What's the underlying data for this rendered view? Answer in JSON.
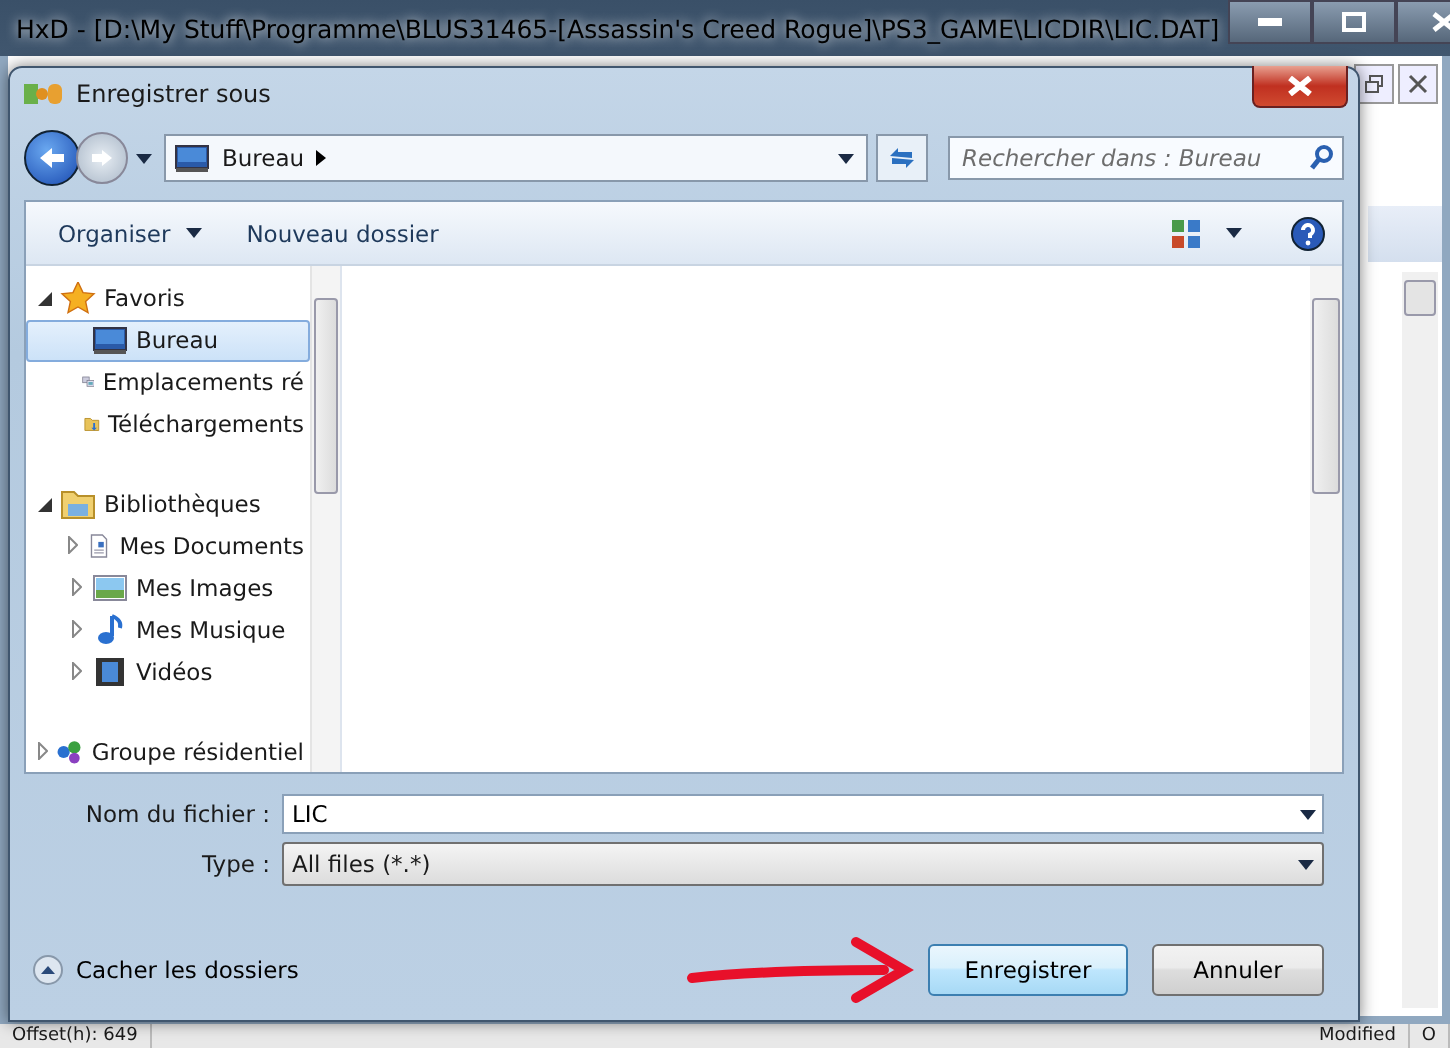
{
  "background_window": {
    "title": "HxD - [D:\\My Stuff\\Programme\\BLUS31465-[Assassin's Creed Rogue]\\PS3_GAME\\LICDIR\\LIC.DAT]",
    "status_bar": [
      "Offset(h): 649",
      "Modified",
      "O"
    ]
  },
  "dialog": {
    "title": "Enregistrer sous",
    "address": "Bureau",
    "search": {
      "placeholder": "Rechercher dans : Bureau"
    },
    "toolbar": [
      {
        "label": "Organiser",
        "dropdown": true
      },
      {
        "label": "Nouveau dossier",
        "dropdown": false
      }
    ],
    "nav_tree": [
      {
        "label": "Favoris",
        "kind": "star",
        "expanded": true,
        "selected": false,
        "children": [
          {
            "label": "Bureau",
            "kind": "desktop",
            "selected": true
          },
          {
            "label": "Emplacements ré",
            "kind": "places",
            "selected": false
          },
          {
            "label": "Téléchargements",
            "kind": "downloads",
            "selected": false
          }
        ]
      },
      {
        "label": "Bibliothèques",
        "kind": "library",
        "expanded": true,
        "selected": false,
        "children": [
          {
            "label": "Mes Documents",
            "kind": "documents",
            "expanded": false,
            "selected": false
          },
          {
            "label": "Mes Images",
            "kind": "images",
            "expanded": false,
            "selected": false
          },
          {
            "label": "Mes Musique",
            "kind": "music",
            "expanded": false,
            "selected": false
          },
          {
            "label": "Vidéos",
            "kind": "videos",
            "expanded": false,
            "selected": false
          }
        ]
      },
      {
        "label": "Groupe résidentiel",
        "kind": "homegroup",
        "expanded": false,
        "selected": false
      }
    ],
    "fields": [
      {
        "label": "Nom du fichier :",
        "value": "LIC",
        "kind": "input"
      },
      {
        "label": "Type :",
        "value": "All files (*.*)",
        "kind": "select"
      }
    ],
    "hide_folders": "Cacher les dossiers",
    "buttons": [
      {
        "label": "Enregistrer",
        "default": true
      },
      {
        "label": "Annuler",
        "default": false
      }
    ]
  }
}
